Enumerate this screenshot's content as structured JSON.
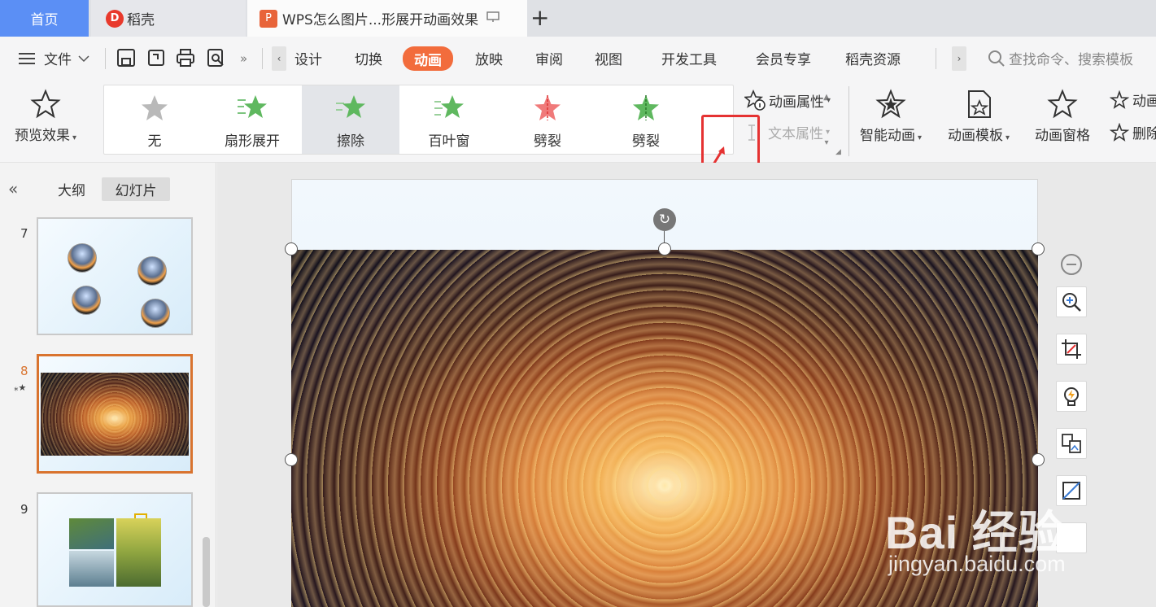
{
  "tabs": {
    "home": "首页",
    "daoke": "稻壳",
    "document": "WPS怎么图片...形展开动画效果"
  },
  "menu": {
    "file": "文件",
    "items": [
      "设计",
      "切换",
      "动画",
      "放映",
      "审阅",
      "视图",
      "开发工具",
      "会员专享",
      "稻壳资源"
    ],
    "search_placeholder": "查找命令、搜索模板"
  },
  "ribbon": {
    "preview": "预览效果",
    "gallery": [
      "无",
      "扇形展开",
      "擦除",
      "百叶窗",
      "劈裂",
      "劈裂"
    ],
    "anim_props": "动画属性",
    "text_props": "文本属性",
    "smart_anim": "智能动画",
    "anim_template": "动画模板",
    "anim_pane": "动画窗格",
    "right_top": "动画",
    "right_bottom": "删除"
  },
  "left_panel": {
    "outline_tab": "大纲",
    "slides_tab": "幻灯片",
    "slide_numbers": [
      "7",
      "8",
      "9"
    ]
  },
  "watermark": {
    "main": "Bai 经验",
    "sub": "jingyan.baidu.com"
  },
  "colors": {
    "accent": "#f26c3c",
    "home_tab": "#5b8ff5",
    "highlight": "#e53232",
    "selected_thumb": "#d9732e"
  }
}
